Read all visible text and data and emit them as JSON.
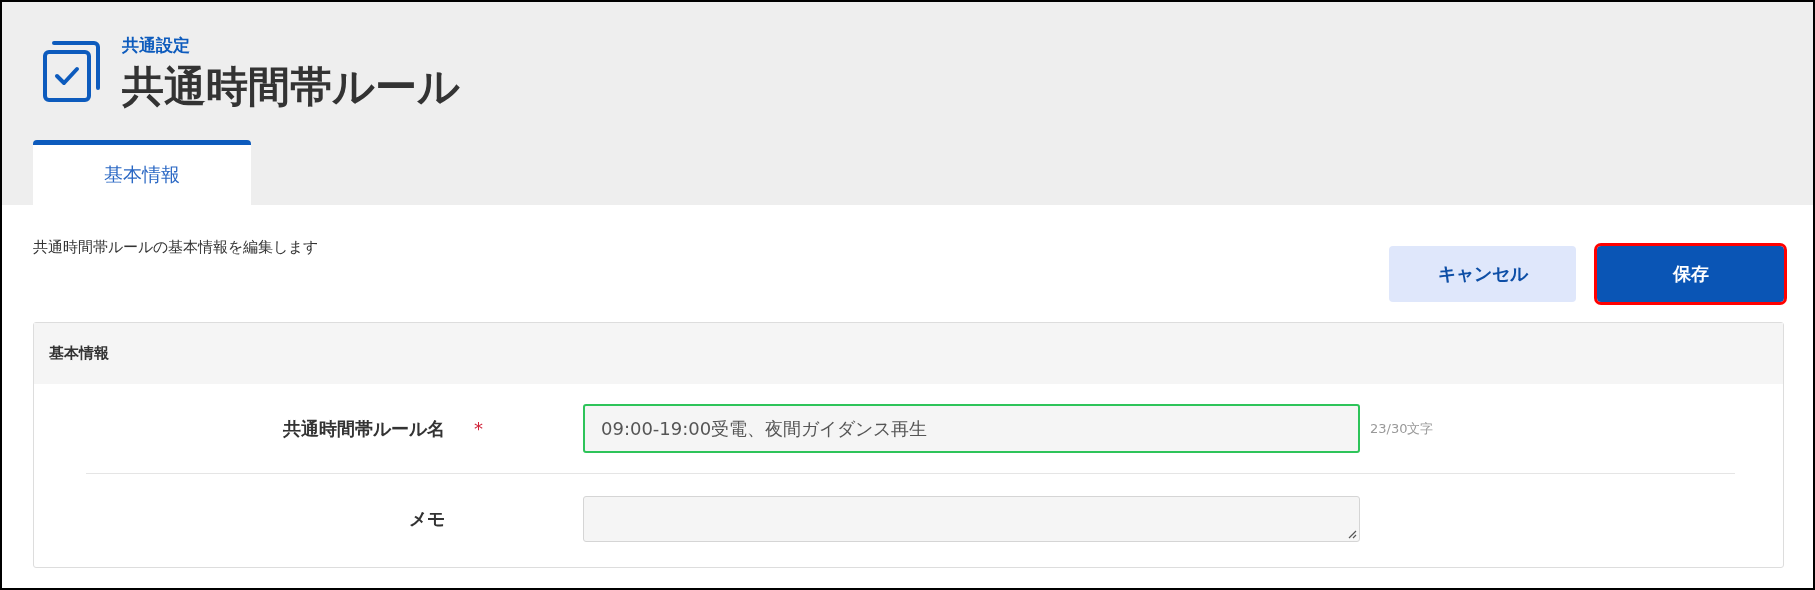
{
  "header": {
    "breadcrumb": "共通設定",
    "title": "共通時間帯ルール"
  },
  "tabs": [
    {
      "label": "基本情報",
      "selected": true
    }
  ],
  "description": "共通時間帯ルールの基本情報を編集します",
  "buttons": [
    {
      "label": "キャンセル",
      "kind": "secondary",
      "highlighted": false
    },
    {
      "label": "保存",
      "kind": "primary",
      "highlighted": true
    }
  ],
  "section": {
    "title": "基本情報",
    "fields": [
      {
        "label": "共通時間帯ルール名",
        "required_mark": "*",
        "kind": "text",
        "value": "09:00-19:00受電、夜間ガイダンス再生",
        "focused": true,
        "counter": "23/30文字"
      },
      {
        "label": "メモ",
        "kind": "textarea",
        "focused": false
      }
    ]
  }
}
